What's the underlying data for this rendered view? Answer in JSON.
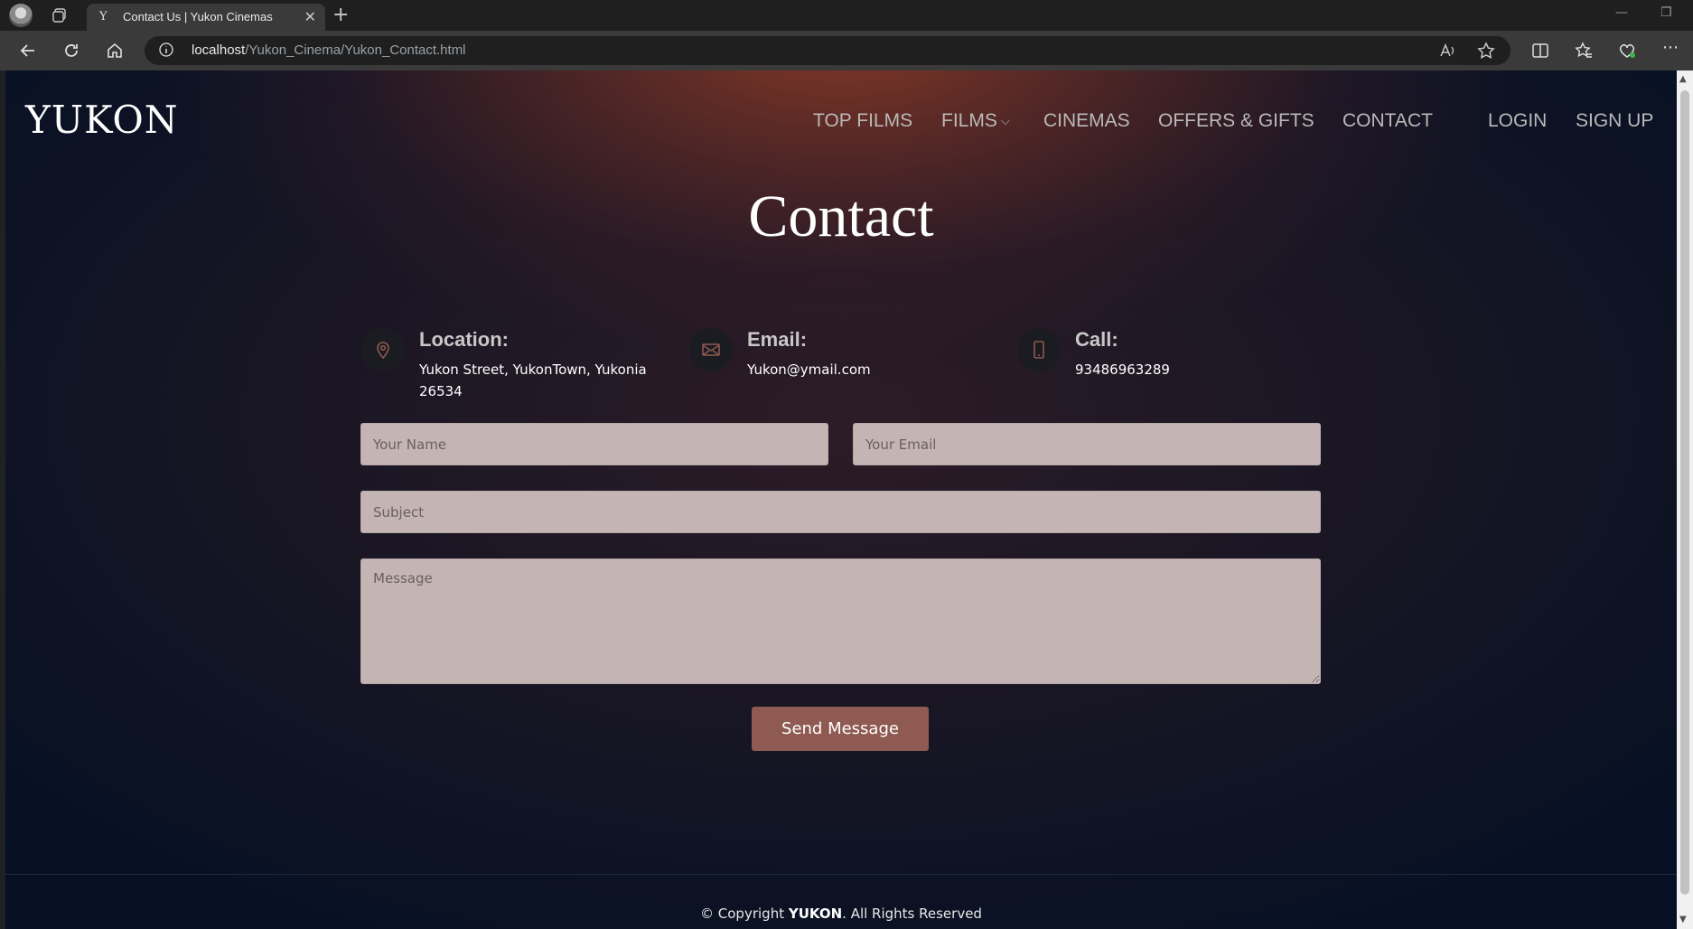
{
  "browser": {
    "tab_title": "Contact Us | Yukon Cinemas",
    "tab_favicon": "Y",
    "url_host": "localhost",
    "url_path": "/Yukon_Cinema/Yukon_Contact.html"
  },
  "header": {
    "logo": "YUKON",
    "nav": [
      "TOP FILMS",
      "FILMS",
      "CINEMAS",
      "OFFERS & GIFTS",
      "CONTACT",
      "LOGIN",
      "SIGN UP"
    ]
  },
  "page": {
    "title": "Contact"
  },
  "info": {
    "location_label": "Location:",
    "location_value": "Yukon Street, YukonTown, Yukonia 26534",
    "email_label": "Email:",
    "email_value": "Yukon@ymail.com",
    "call_label": "Call:",
    "call_value": "93486963289"
  },
  "form": {
    "name_placeholder": "Your Name",
    "email_placeholder": "Your Email",
    "subject_placeholder": "Subject",
    "message_placeholder": "Message",
    "send_label": "Send Message"
  },
  "footer": {
    "prefix": "© Copyright ",
    "brand": "YUKON",
    "suffix": ". All Rights Reserved"
  },
  "colors": {
    "accent": "#8e5a51",
    "field_bg": "#c4b5b4",
    "page_bg": "#061024"
  }
}
